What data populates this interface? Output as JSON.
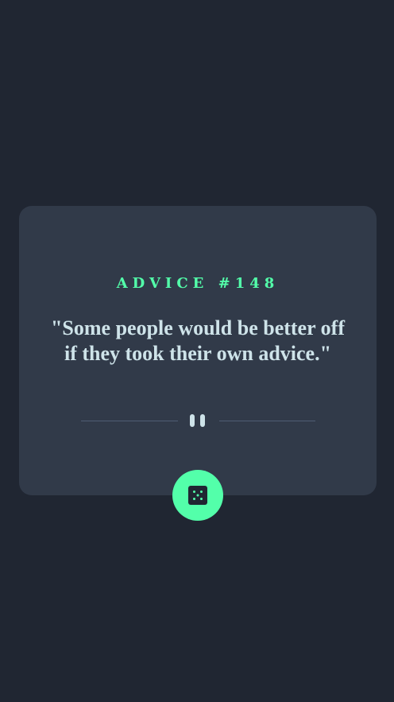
{
  "advice": {
    "id_label": "ADVICE #148",
    "text": "\"Some people would be better off if they took their own advice.\""
  },
  "divider": {
    "icon": "pause-icon"
  },
  "dice_button": {
    "icon": "dice-icon"
  },
  "colors": {
    "background": "#202632",
    "card": "#313a49",
    "accent": "#53ffaa",
    "text": "#cee3e9",
    "divider": "#4f5d74"
  }
}
